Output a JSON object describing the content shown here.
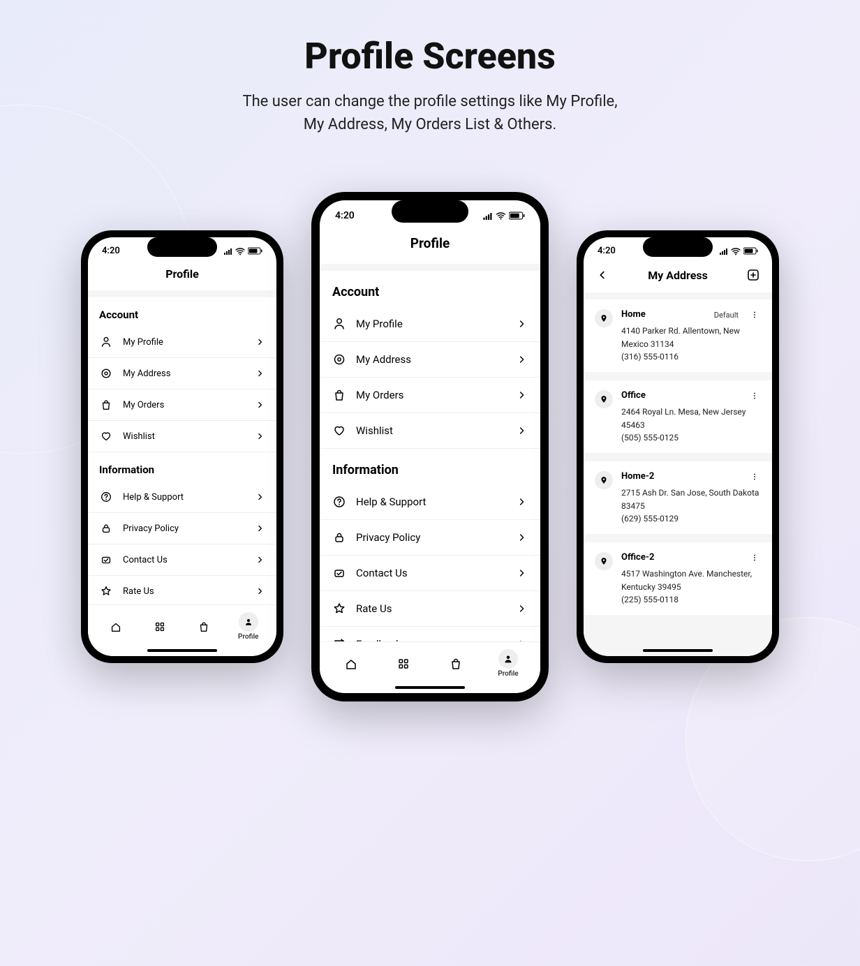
{
  "header": {
    "title": "Profile Screens",
    "subtitle_line1": "The user can change the profile settings like My Profile,",
    "subtitle_line2": "My Address, My Orders List & Others."
  },
  "status": {
    "time": "4:20"
  },
  "profile": {
    "title": "Profile",
    "sections": {
      "account": {
        "label": "Account",
        "items": [
          {
            "label": "My Profile",
            "icon": "user"
          },
          {
            "label": "My Address",
            "icon": "location"
          },
          {
            "label": "My Orders",
            "icon": "bag"
          },
          {
            "label": "Wishlist",
            "icon": "heart"
          }
        ]
      },
      "information": {
        "label": "Information",
        "items": [
          {
            "label": "Help & Support",
            "icon": "help"
          },
          {
            "label": "Privacy Policy",
            "icon": "lock"
          },
          {
            "label": "Contact Us",
            "icon": "mail"
          },
          {
            "label": "Rate Us",
            "icon": "star"
          },
          {
            "label": "Feedback",
            "icon": "feedback"
          }
        ]
      }
    }
  },
  "nav": {
    "active_label": "Profile"
  },
  "address": {
    "title": "My Address",
    "items": [
      {
        "name": "Home",
        "default": true,
        "line": "4140 Parker Rd. Allentown, New Mexico 31134",
        "phone": "(316) 555-0116"
      },
      {
        "name": "Office",
        "default": false,
        "line": "2464 Royal Ln. Mesa, New Jersey 45463",
        "phone": "(505) 555-0125"
      },
      {
        "name": "Home-2",
        "default": false,
        "line": "2715 Ash Dr. San Jose, South Dakota 83475",
        "phone": "(629) 555-0129"
      },
      {
        "name": "Office-2",
        "default": false,
        "line": "4517 Washington Ave. Manchester, Kentucky 39495",
        "phone": "(225) 555-0118"
      }
    ],
    "default_label": "Default"
  }
}
